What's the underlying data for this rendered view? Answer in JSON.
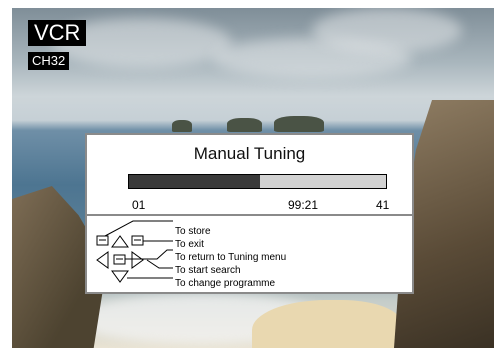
{
  "osd": {
    "mode_label": "VCR",
    "channel_label": "CH32"
  },
  "manual_tuning": {
    "title": "Manual Tuning",
    "progress_fraction": 0.51,
    "left_value": "01",
    "center_value": "99:21",
    "right_value": "41"
  },
  "legend": {
    "items": [
      {
        "icon": "ok-key-icon",
        "label": "To store"
      },
      {
        "icon": "back-key-icon",
        "label": "To exit"
      },
      {
        "icon": "menu-key-icon",
        "label": "To return to Tuning menu"
      },
      {
        "icon": "left-right-arrows-icon",
        "label": "To start search"
      },
      {
        "icon": "up-down-arrows-icon",
        "label": "To change programme"
      }
    ]
  },
  "colors": {
    "osd_background": "#000000",
    "panel_background": "#ffffff",
    "bar_fill": "#3a3a3a",
    "bar_track": "#d2d2d2"
  }
}
